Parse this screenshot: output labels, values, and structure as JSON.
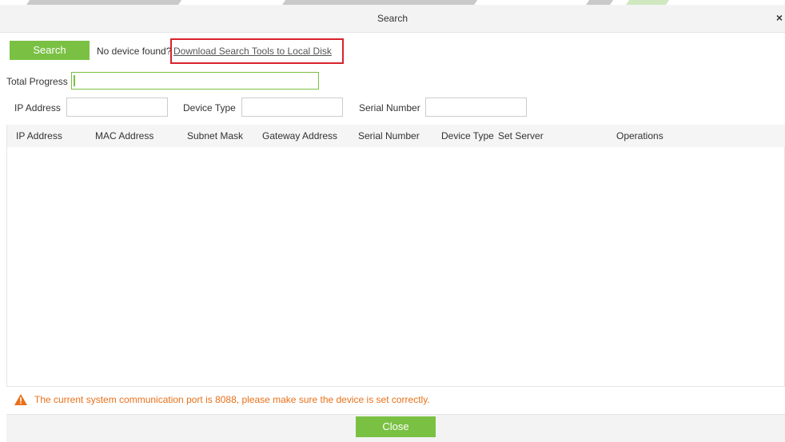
{
  "dialog": {
    "title": "Search",
    "close_icon": "close-icon"
  },
  "search": {
    "button_label": "Search",
    "no_device_text": "No device found?",
    "download_link": "Download Search Tools to Local Disk"
  },
  "progress": {
    "label": "Total Progress",
    "value": 0
  },
  "filters": {
    "ip_label": "IP Address",
    "ip_value": "",
    "device_type_label": "Device Type",
    "device_type_value": "",
    "serial_label": "Serial Number",
    "serial_value": ""
  },
  "table": {
    "columns": [
      "IP Address",
      "MAC Address",
      "Subnet Mask",
      "Gateway Address",
      "Serial Number",
      "Device Type",
      "Set Server",
      "Operations"
    ],
    "rows": []
  },
  "warning": {
    "icon": "warning-icon",
    "text": "The current system communication port is 8088, please make sure the device is set correctly."
  },
  "footer": {
    "close_label": "Close"
  },
  "colors": {
    "accent": "#7ac143",
    "highlight": "#d9232d",
    "warning": "#e8701a"
  }
}
